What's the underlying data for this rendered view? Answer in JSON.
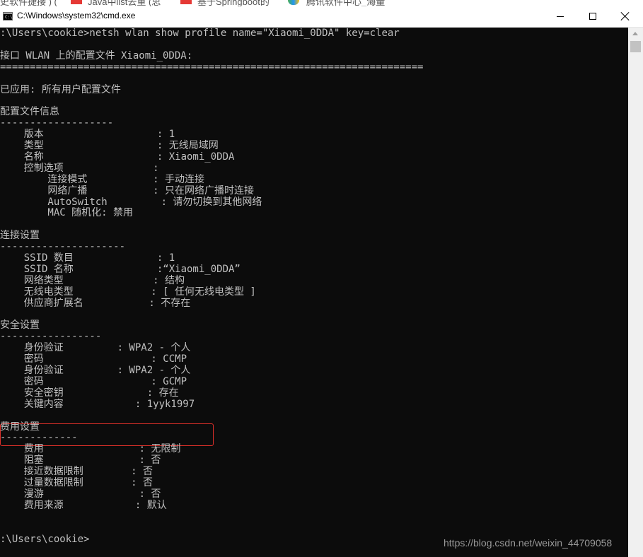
{
  "background_taskbar": {
    "fragments": [
      "史软件捷接  )  (",
      "Java中list去重 (思",
      "基于Springboot的",
      "腾讯软件中心_海量"
    ],
    "brand_color": "#e53935"
  },
  "window": {
    "title": "C:\\Windows\\system32\\cmd.exe",
    "icon": "cmd-icon",
    "controls": [
      "minimize",
      "maximize",
      "close"
    ]
  },
  "console": {
    "text_color": "#c0c0c0",
    "background": "#0c0c0c",
    "lines": [
      ":\\Users\\cookie>netsh wlan show profile name=\"Xiaomi_0DDA\" key=clear",
      "",
      "接口 WLAN 上的配置文件 Xiaomi_0DDA:",
      "=======================================================================",
      "",
      "已应用: 所有用户配置文件",
      "",
      "配置文件信息",
      "-------------------",
      "    版本                   : 1",
      "    类型                   : 无线局域网",
      "    名称                   : Xiaomi_0DDA",
      "    控制选项               :",
      "        连接模式           : 手动连接",
      "        网络广播           : 只在网络广播时连接",
      "        AutoSwitch         : 请勿切换到其他网络",
      "        MAC 随机化: 禁用",
      "",
      "连接设置",
      "---------------------",
      "    SSID 数目              : 1",
      "    SSID 名称              :“Xiaomi_0DDA”",
      "    网络类型               : 结构",
      "    无线电类型             : [ 任何无线电类型 ]",
      "    供应商扩展名           : 不存在",
      "",
      "安全设置",
      "-----------------",
      "    身份验证         : WPA2 - 个人",
      "    密码                  : CCMP",
      "    身份验证         : WPA2 - 个人",
      "    密码                  : GCMP",
      "    安全密钥              : 存在",
      "    关键内容            : 1yyk1997",
      "",
      "费用设置",
      "-------------",
      "    费用                : 无限制",
      "    阻塞                : 否",
      "    接近数据限制        : 否",
      "    过量数据限制        : 否",
      "    漫游                : 否",
      "    费用来源            : 默认",
      "",
      "",
      ":\\Users\\cookie>"
    ],
    "highlight_color": "#e0302a"
  },
  "watermark": "https://blog.csdn.net/weixin_44709058"
}
